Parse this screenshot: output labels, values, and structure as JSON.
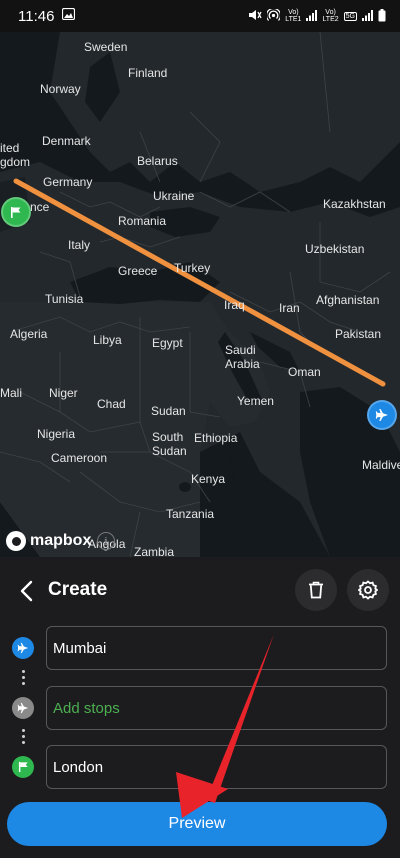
{
  "status_bar": {
    "time": "11:46",
    "net1": "Vo)\nLTE1",
    "net2": "Vo)\nLTE2",
    "net_5g": "5G"
  },
  "map": {
    "labels": {
      "sweden": "Sweden",
      "finland": "Finland",
      "norway": "Norway",
      "united_kingdom": "ited\ngdom",
      "denmark": "Denmark",
      "belarus": "Belarus",
      "germany": "Germany",
      "ukraine": "Ukraine",
      "france": "France",
      "kazakhstan": "Kazakhstan",
      "romania": "Romania",
      "italy": "Italy",
      "uzbekistan": "Uzbekistan",
      "turkey": "Turkey",
      "greece": "Greece",
      "iran": "Iran",
      "afghanistan": "Afghanistan",
      "tunisia": "Tunisia",
      "iraq": "Iraq",
      "algeria": "Algeria",
      "libya": "Libya",
      "egypt": "Egypt",
      "pakistan": "Pakistan",
      "saudi_arabia": "Saudi\nArabia",
      "oman": "Oman",
      "mali": "Mali",
      "niger": "Niger",
      "chad": "Chad",
      "yemen": "Yemen",
      "sudan": "Sudan",
      "nigeria": "Nigeria",
      "south_sudan": "South\nSudan",
      "ethiopia": "Ethiopia",
      "cameroon": "Cameroon",
      "maldives": "Maldive",
      "kenya": "Kenya",
      "tanzania": "Tanzania",
      "angola": "Angola",
      "zambia": "Zambia"
    },
    "attribution": "mapbox",
    "route_color": "#f0913f"
  },
  "panel": {
    "title": "Create",
    "origin_value": "Mumbai",
    "stops_placeholder": "Add stops",
    "destination_value": "London",
    "preview_label": "Preview"
  },
  "colors": {
    "accent_blue": "#1e88e5",
    "green": "#2fb84f",
    "annotation_red": "#e8232a"
  }
}
